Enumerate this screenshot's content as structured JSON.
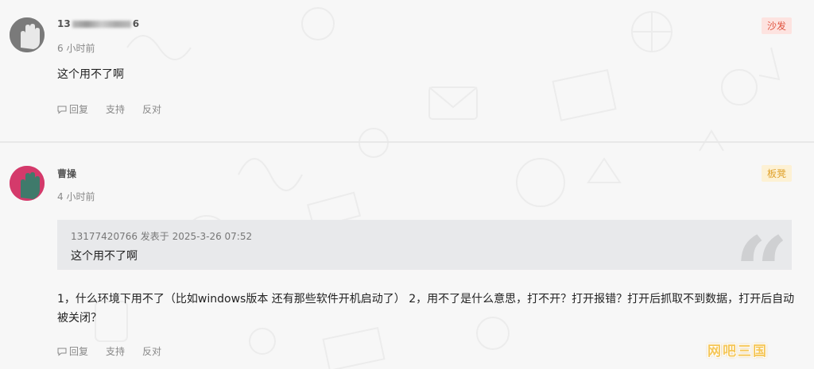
{
  "comments": [
    {
      "username_prefix": "13",
      "username_suffix": "6",
      "time": "6 小时前",
      "text": "这个用不了啊",
      "badge": "沙发",
      "actions": {
        "reply": "回复",
        "support": "支持",
        "oppose": "反对"
      }
    },
    {
      "username": "曹操",
      "time": "4 小时前",
      "quote": {
        "meta": "13177420766 发表于 2025-3-26 07:52",
        "body": "这个用不了啊",
        "mark": "“"
      },
      "text": "1，什么环境下用不了（比如windows版本  还有那些软件开机启动了）  2，用不了是什么意思，打不开？打开报错？打开后抓取不到数据，打开后自动被关闭？",
      "badge": "板凳",
      "actions": {
        "reply": "回复",
        "support": "支持",
        "oppose": "反对"
      }
    }
  ],
  "watermark": "网吧三国",
  "colors": {
    "sofa_badge_bg": "#fde3e0",
    "sofa_badge_text": "#e0523e",
    "bench_badge_bg": "#fdf1d4",
    "bench_badge_text": "#e0a12b"
  }
}
